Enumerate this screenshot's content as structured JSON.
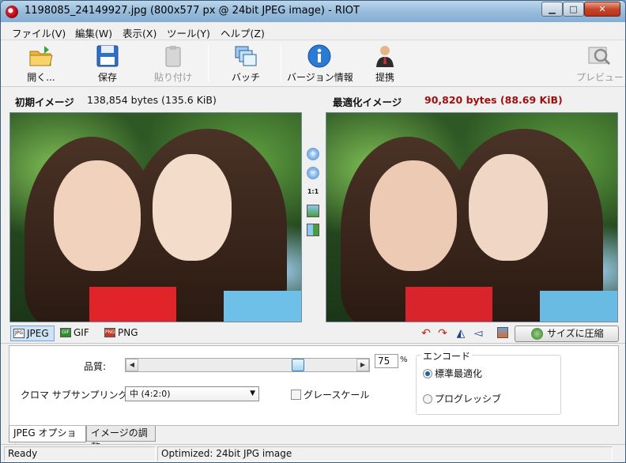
{
  "window": {
    "title": "1198085_24149927.jpg (800x577 px @ 24bit JPEG image) - RIOT",
    "minimize": "▁",
    "maximize": "□",
    "close": "✕"
  },
  "menu": [
    "ファイル(V)",
    "編集(W)",
    "表示(X)",
    "ツール(Y)",
    "ヘルプ(Z)"
  ],
  "toolbar": {
    "open": "開く...",
    "save": "保存",
    "paste": "貼り付け",
    "batch": "バッチ",
    "version": "バージョン情報",
    "sponsor": "提携",
    "preview": "プレビュー"
  },
  "header": {
    "original_label": "初期イメージ",
    "original_size": "138,854 bytes (135.6 KiB)",
    "optimized_label": "最適化イメージ",
    "optimized_size": "90,820 bytes (88.69 KiB)",
    "optimized_color": "#a01010"
  },
  "zoom": {
    "one_to_one": "1:1"
  },
  "formats": {
    "jpeg": "JPEG",
    "gif": "GIF",
    "png": "PNG",
    "jpeg_icon": "JPG",
    "gif_icon": "GIF",
    "png_icon": "PNG"
  },
  "compress_button": "サイズに圧縮",
  "options": {
    "quality_label": "品質:",
    "quality_value": "75",
    "quality_unit": "%",
    "chroma_label": "クロマ サブサンプリング:",
    "chroma_value": "中 (4:2:0)",
    "grayscale": "グレースケール",
    "encode_legend": "エンコード",
    "encode_standard": "標準最適化",
    "encode_progressive": "プログレッシブ"
  },
  "tabs": [
    "JPEG オプション",
    "イメージの調整"
  ],
  "status": {
    "state": "Ready",
    "message": "Optimized: 24bit JPG image"
  }
}
